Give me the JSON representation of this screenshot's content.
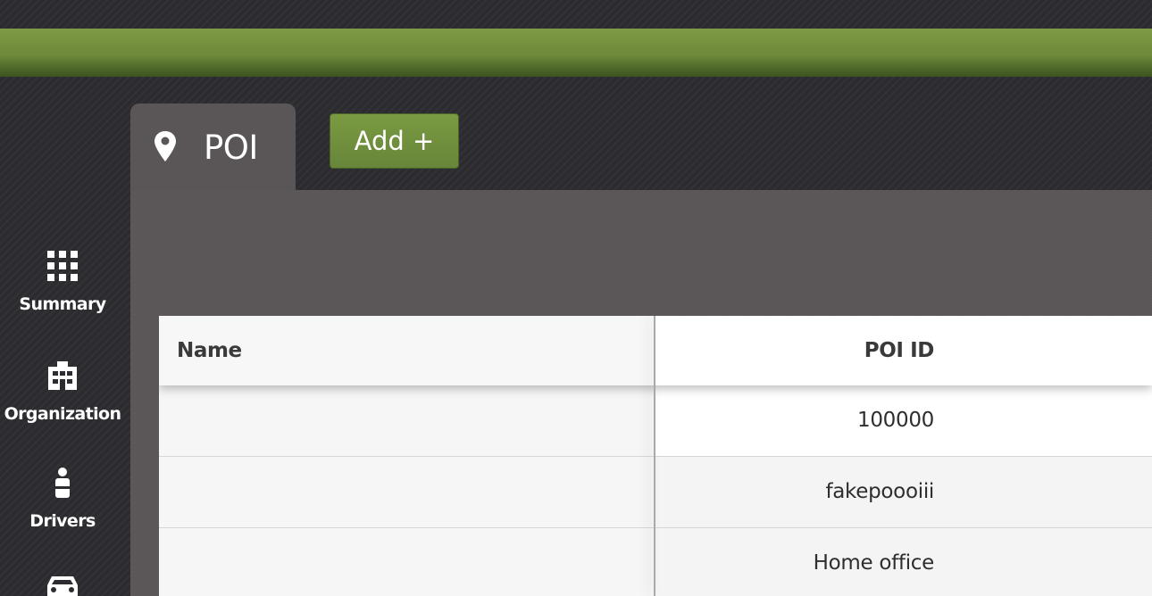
{
  "tab": {
    "icon": "map-pin-icon",
    "title": "POI"
  },
  "toolbar": {
    "add_label": "Add +"
  },
  "sidebar": {
    "items": [
      {
        "icon": "grid-icon",
        "label": "Summary"
      },
      {
        "icon": "building-icon",
        "label": "Organization"
      },
      {
        "icon": "driver-icon",
        "label": "Drivers"
      },
      {
        "icon": "car-icon",
        "label": ""
      }
    ]
  },
  "table": {
    "columns": [
      "Name",
      "POI ID"
    ],
    "rows": [
      {
        "name": "",
        "poi_id": "100000"
      },
      {
        "name": "",
        "poi_id": "fakepoooiii"
      },
      {
        "name": "",
        "poi_id": "Home office"
      }
    ]
  },
  "colors": {
    "accent_green": "#6e8a3a",
    "background": "#2c2b2f",
    "panel": "#5a5657"
  }
}
